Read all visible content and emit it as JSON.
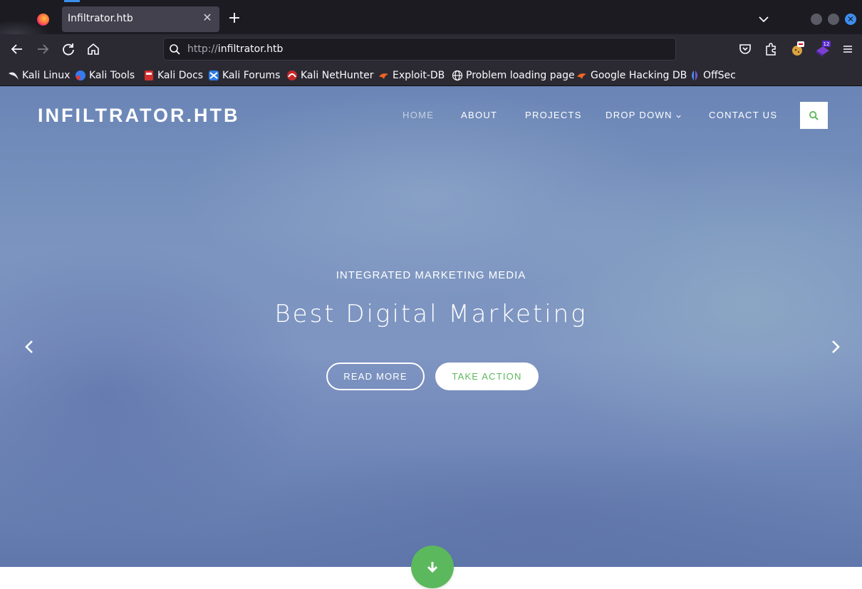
{
  "browser": {
    "tab": {
      "title": "Infiltrator.htb"
    },
    "url": {
      "protocol": "http://",
      "host": "infiltrator.htb"
    },
    "extension_badge": "12",
    "bookmarks": [
      {
        "label": "Kali Linux",
        "icon": "kali-dragon-icon"
      },
      {
        "label": "Kali Tools",
        "icon": "kali-tools-icon"
      },
      {
        "label": "Kali Docs",
        "icon": "kali-docs-icon"
      },
      {
        "label": "Kali Forums",
        "icon": "kali-forums-icon"
      },
      {
        "label": "Kali NetHunter",
        "icon": "nethunter-icon"
      },
      {
        "label": "Exploit-DB",
        "icon": "exploit-db-icon"
      },
      {
        "label": "Problem loading page",
        "icon": "globe-icon"
      },
      {
        "label": "Google Hacking DB",
        "icon": "ghdb-icon"
      },
      {
        "label": "OffSec",
        "icon": "offsec-icon"
      }
    ]
  },
  "site": {
    "logo": "INFILTRATOR.HTB",
    "nav": {
      "home": "HOME",
      "about": "ABOUT",
      "projects": "PROJECTS",
      "dropdown": "DROP DOWN",
      "contact": "CONTACT US"
    },
    "hero": {
      "subtitle": "INTEGRATED MARKETING MEDIA",
      "headline": "Best Digital Marketing",
      "read_more": "READ MORE",
      "take_action": "TAKE ACTION"
    },
    "colors": {
      "accent": "#5cb85c",
      "hero_sky": "#7a94bf"
    }
  }
}
